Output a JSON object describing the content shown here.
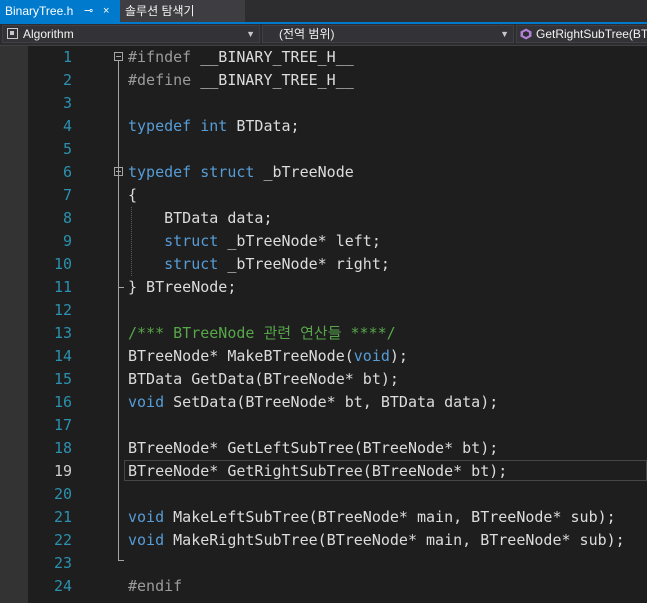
{
  "tabs": {
    "active_label": "BinaryTree.h",
    "pin_icon": "⊸",
    "close_icon": "×",
    "inactive_label": "솔루션 탐색기"
  },
  "navbar": {
    "project": "Algorithm",
    "scope": "(전역 범위)",
    "member": "GetRightSubTree(BTreeNode* bt)",
    "dropdown_arrow": "▼"
  },
  "editor": {
    "current_line": 19,
    "lines": [
      {
        "num": "1",
        "code": "#ifndef __BINARY_TREE_H__"
      },
      {
        "num": "2",
        "code": "#define __BINARY_TREE_H__"
      },
      {
        "num": "3",
        "code": ""
      },
      {
        "num": "4",
        "code": "typedef int BTData;"
      },
      {
        "num": "5",
        "code": ""
      },
      {
        "num": "6",
        "code": "typedef struct _bTreeNode"
      },
      {
        "num": "7",
        "code": "{"
      },
      {
        "num": "8",
        "code": "    BTData data;"
      },
      {
        "num": "9",
        "code": "    struct _bTreeNode* left;"
      },
      {
        "num": "10",
        "code": "    struct _bTreeNode* right;"
      },
      {
        "num": "11",
        "code": "} BTreeNode;"
      },
      {
        "num": "12",
        "code": ""
      },
      {
        "num": "13",
        "code": "/*** BTreeNode 관련 연산들 ****/"
      },
      {
        "num": "14",
        "code": "BTreeNode* MakeBTreeNode(void);"
      },
      {
        "num": "15",
        "code": "BTData GetData(BTreeNode* bt);"
      },
      {
        "num": "16",
        "code": "void SetData(BTreeNode* bt, BTData data);"
      },
      {
        "num": "17",
        "code": ""
      },
      {
        "num": "18",
        "code": "BTreeNode* GetLeftSubTree(BTreeNode* bt);"
      },
      {
        "num": "19",
        "code": "BTreeNode* GetRightSubTree(BTreeNode* bt);"
      },
      {
        "num": "20",
        "code": ""
      },
      {
        "num": "21",
        "code": "void MakeLeftSubTree(BTreeNode* main, BTreeNode* sub);"
      },
      {
        "num": "22",
        "code": "void MakeRightSubTree(BTreeNode* main, BTreeNode* sub);"
      },
      {
        "num": "23",
        "code": ""
      },
      {
        "num": "24",
        "code": "#endif"
      }
    ]
  },
  "colors": {
    "accent": "#007acc",
    "keyword": "#569cd6",
    "preprocessor": "#9b9b9b",
    "comment": "#57a64a",
    "line_number": "#2b91af",
    "background": "#1e1e1e"
  }
}
